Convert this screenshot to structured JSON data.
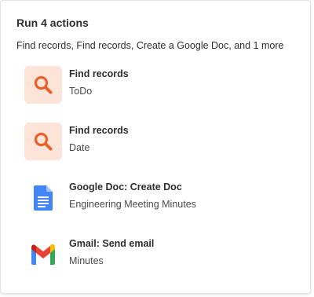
{
  "header": {
    "title": "Run 4 actions",
    "summary": "Find records, Find records, Create a Google Doc, and 1 more"
  },
  "actions": [
    {
      "name": "Find records",
      "detail": "ToDo",
      "icon": "search-icon",
      "icon_bg": "#fde4d9",
      "icon_color": "#e8602c"
    },
    {
      "name": "Find records",
      "detail": "Date",
      "icon": "search-icon",
      "icon_bg": "#fde4d9",
      "icon_color": "#e8602c"
    },
    {
      "name": "Google Doc: Create Doc",
      "detail": "Engineering Meeting Minutes",
      "icon": "google-docs-icon",
      "icon_color": "#4285f4"
    },
    {
      "name": "Gmail: Send email",
      "detail": "Minutes",
      "icon": "gmail-icon"
    }
  ]
}
